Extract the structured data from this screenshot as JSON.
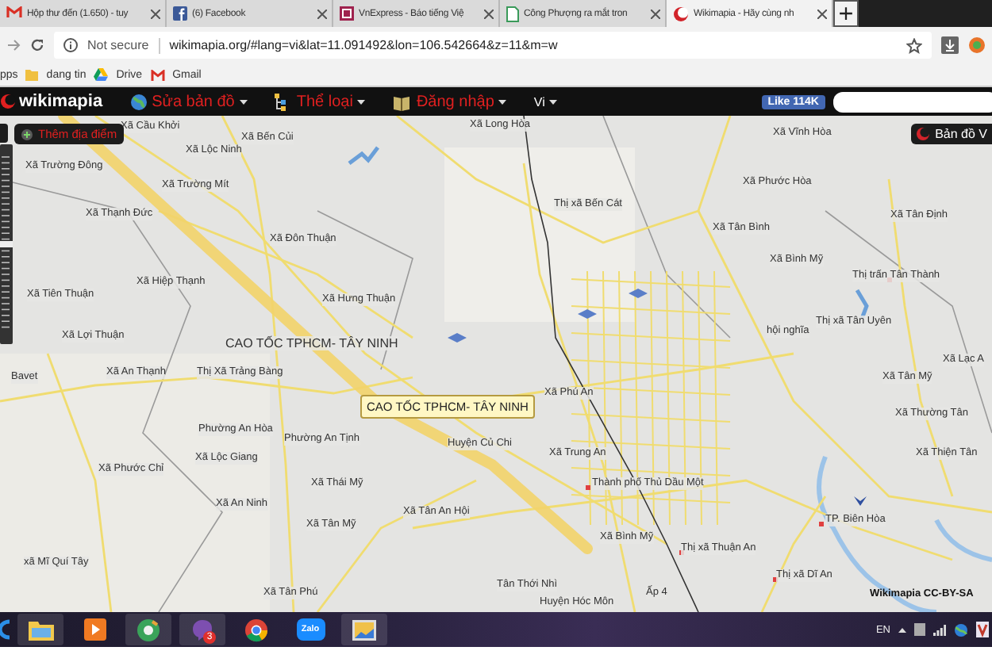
{
  "browser": {
    "tabs": [
      {
        "title": "Hộp thư đến (1.650) - tuy",
        "selected": false
      },
      {
        "title": "(6) Facebook",
        "selected": false
      },
      {
        "title": "VnExpress - Báo tiếng Việ",
        "selected": false
      },
      {
        "title": "Công Phượng ra mắt tron",
        "selected": false
      },
      {
        "title": "Wikimapia - Hãy cùng nh",
        "selected": true
      }
    ],
    "address_bar": {
      "security": "Not secure",
      "url": "wikimapia.org/#lang=vi&lat=11.091492&lon=106.542664&z=11&m=w"
    },
    "bookmarks": [
      "pps",
      "dang tin",
      "Drive",
      "Gmail"
    ]
  },
  "wikimapia_toolbar": {
    "logo": "wikimapia",
    "menu": [
      "Sửa bản đồ",
      "Thể loại",
      "Đăng nhập",
      "Vi"
    ],
    "like_button": "Like 114K"
  },
  "map": {
    "add_place_button": "Thêm địa điểm",
    "map_type_button": "Bản đồ V",
    "place_labels": [
      "Xã Cầu Khởi",
      "Xã Long Hòa",
      "Xã Bến Củi",
      "Xã Vĩnh Hòa",
      "Xã Lộc Ninh",
      "Xã Trường Đông",
      "Xã Phước Hòa",
      "Xã Trường Mít",
      "Thị xã Bến Cát",
      "Xã Thạnh Đức",
      "Xã Tân Định",
      "Xã Tân Bình",
      "Xã Đôn Thuận",
      "Xã Bình Mỹ",
      "Thị trấn Tân Thành",
      "Xã Hiệp Thạnh",
      "Xã Tiên Thuận",
      "Xã Hưng Thuận",
      "Thị xã Tân Uyên",
      "hội nghĩa",
      "Xã Lợi Thuận",
      "Xã Lạc A",
      "Xã An Thạnh",
      "Thị Xã Trảng Bàng",
      "Bavet",
      "Xã Tân Mỹ",
      "Xã Phú An",
      "Xã Thường Tân",
      "Phường An Hòa",
      "Phường An Tịnh",
      "Huyện Củ Chi",
      "Xã Trung An",
      "Xã Thiện Tân",
      "Xã Lộc Giang",
      "Xã Phước Chỉ",
      "Xã Thái Mỹ",
      "Thành phố Thủ Dầu Một",
      "Xã An Ninh",
      "Xã Tân An Hội",
      "TP. Biên Hòa",
      "Xã Tân Mỹ",
      "Xã Bình Mỹ",
      "Thị xã Thuận An",
      "xã Mĩ Quí Tây",
      "Thị xã Dĩ An",
      "Tân Thới Nhì",
      "Xã Tân Phú",
      "Ấp 4",
      "Huyện Hóc Môn"
    ],
    "road_label": "CAO TỐC TPHCM- TÂY NINH",
    "tooltip": "CAO TỐC TPHCM- TÂY NINH",
    "attribution": "Wikimapia CC-BY-SA",
    "zoom_slider": {
      "level": 0.5
    }
  },
  "taskbar": {
    "viber_badge": "3",
    "zalo_label": "Zalo",
    "language": "EN"
  }
}
